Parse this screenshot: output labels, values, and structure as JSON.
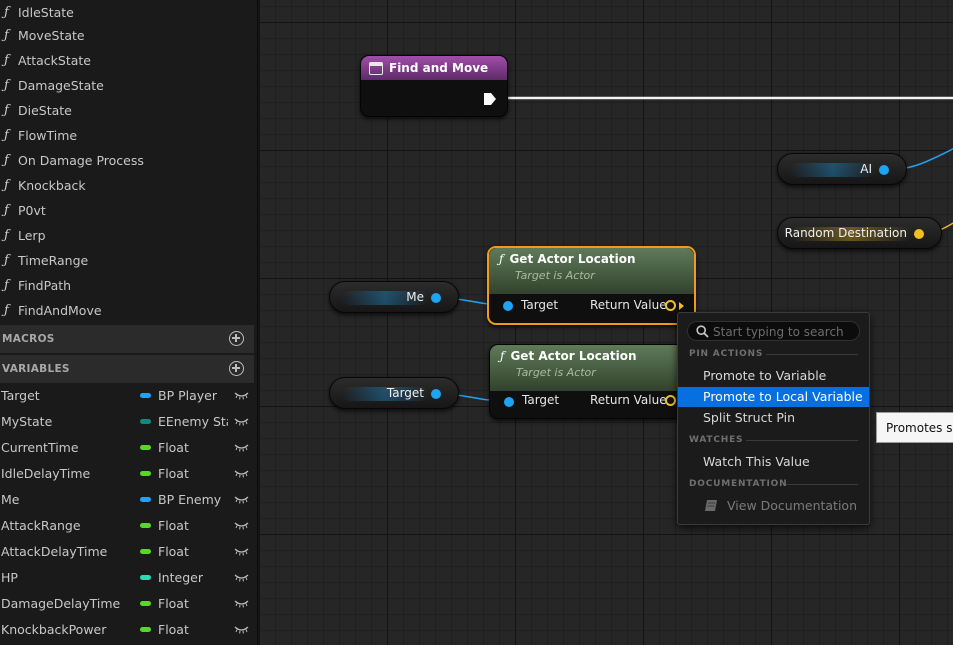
{
  "functions": [
    "IdleState",
    "MoveState",
    "AttackState",
    "DamageState",
    "DieState",
    "FlowTime",
    "On Damage Process",
    "Knockback",
    "P0vt",
    "Lerp",
    "TimeRange",
    "FindPath",
    "FindAndMove"
  ],
  "sections": {
    "macros": "MACROS",
    "variables": "VARIABLES"
  },
  "variables": [
    {
      "name": "Target",
      "type": "BP Player",
      "color": "#1ea4f5"
    },
    {
      "name": "MyState",
      "type": "EEnemy Sta",
      "color": "#138a7c"
    },
    {
      "name": "CurrentTime",
      "type": "Float",
      "color": "#58d62c"
    },
    {
      "name": "IdleDelayTime",
      "type": "Float",
      "color": "#58d62c"
    },
    {
      "name": "Me",
      "type": "BP Enemy",
      "color": "#1ea4f5"
    },
    {
      "name": "AttackRange",
      "type": "Float",
      "color": "#58d62c"
    },
    {
      "name": "AttackDelayTime",
      "type": "Float",
      "color": "#58d62c"
    },
    {
      "name": "HP",
      "type": "Integer",
      "color": "#28dcb4"
    },
    {
      "name": "DamageDelayTime",
      "type": "Float",
      "color": "#58d62c"
    },
    {
      "name": "KnockbackPower",
      "type": "Float",
      "color": "#58d62c"
    }
  ],
  "graph": {
    "event_node": {
      "title": "Find and Move"
    },
    "var_nodes": {
      "ai": "AI",
      "random_destination": "Random Destination",
      "me": "Me",
      "target": "Target"
    },
    "fn_nodes": [
      {
        "title": "Get Actor Location",
        "subtitle": "Target is Actor",
        "in_pin": "Target",
        "out_pin": "Return Value"
      },
      {
        "title": "Get Actor Location",
        "subtitle": "Target is Actor",
        "in_pin": "Target",
        "out_pin": "Return Value"
      }
    ]
  },
  "context_menu": {
    "search_placeholder": "Start typing to search",
    "sections": {
      "pin_actions": "PIN ACTIONS",
      "watches": "WATCHES",
      "documentation": "DOCUMENTATION"
    },
    "items": {
      "promote_variable": "Promote to Variable",
      "promote_local": "Promote to Local Variable",
      "split_struct": "Split Struct Pin",
      "watch_value": "Watch This Value",
      "view_docs": "View Documentation"
    }
  },
  "tooltip": "Promotes so",
  "colors": {
    "object_pin": "#1ea4f5",
    "vector_pin": "#f0c020",
    "selection": "#0770e1",
    "node_highlight": "#f09a1e"
  }
}
